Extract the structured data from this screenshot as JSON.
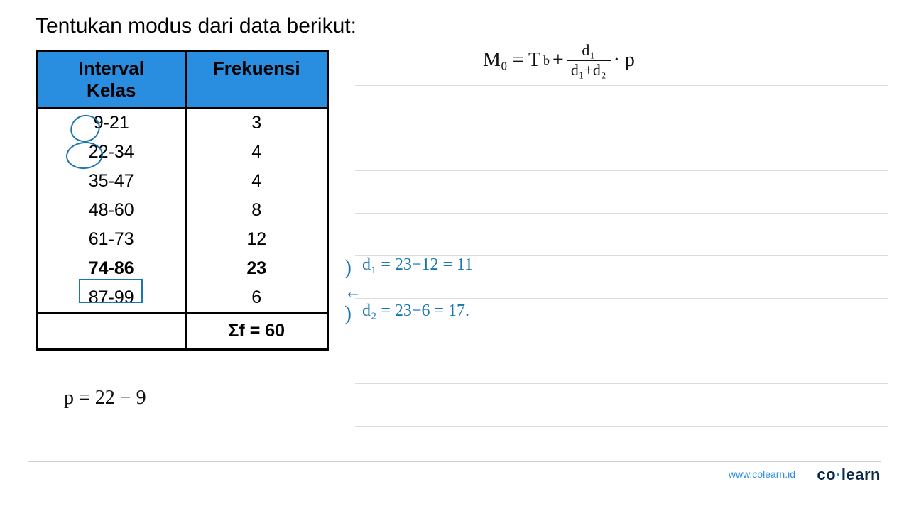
{
  "title": "Tentukan modus dari data berikut:",
  "table": {
    "headers": {
      "col1": "Interval\nKelas",
      "col2": "Frekuensi"
    },
    "rows": [
      {
        "interval": "9-21",
        "freq": "3"
      },
      {
        "interval": "22-34",
        "freq": "4"
      },
      {
        "interval": "35-47",
        "freq": "4"
      },
      {
        "interval": "48-60",
        "freq": "8"
      },
      {
        "interval": "61-73",
        "freq": "12"
      },
      {
        "interval": "74-86",
        "freq": "23"
      },
      {
        "interval": "87-99",
        "freq": "6"
      }
    ],
    "footer": {
      "left": "",
      "right": "Σf = 60"
    }
  },
  "annotations": {
    "p_expr": "p = 22 − 9",
    "formula_lhs": "M₀ = T",
    "formula_b": "b",
    "formula_plus": " + ",
    "formula_num": "d₁",
    "formula_den": "d₁+d₂",
    "formula_tail": " · p",
    "d1_brace": ")",
    "d1_expr": "d₁ = 23−12 = 11",
    "arrow": "←",
    "d2_brace": ")",
    "d2_expr": "d₂ = 23−6 = 17."
  },
  "footer": {
    "url": "www.colearn.id",
    "logo_a": "co",
    "logo_dot": "·",
    "logo_b": "learn"
  },
  "chart_data": {
    "type": "table",
    "title": "Tentukan modus dari data berikut:",
    "columns": [
      "Interval Kelas",
      "Frekuensi"
    ],
    "rows": [
      [
        "9-21",
        3
      ],
      [
        "22-34",
        4
      ],
      [
        "35-47",
        4
      ],
      [
        "48-60",
        8
      ],
      [
        "61-73",
        12
      ],
      [
        "74-86",
        23
      ],
      [
        "87-99",
        6
      ]
    ],
    "sum_frequency": 60,
    "modal_class": "74-86",
    "d1": 11,
    "d2": 17,
    "p_expression": "22 - 9",
    "formula": "M0 = Tb + d1/(d1+d2) * p"
  }
}
